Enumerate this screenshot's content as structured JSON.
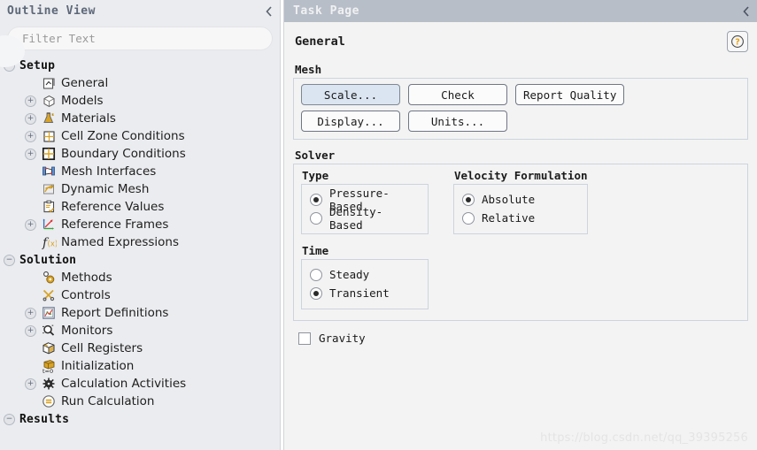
{
  "outline": {
    "title": "Outline View",
    "collapse_icon": "chevron-left-icon",
    "filter": {
      "value": "",
      "placeholder": "Filter Text"
    },
    "tree": [
      {
        "label": "Setup",
        "level": 0,
        "expander": "minus",
        "icon": "none",
        "section": true
      },
      {
        "label": "General",
        "level": 1,
        "expander": "none",
        "icon": "general-icon",
        "section": false
      },
      {
        "label": "Models",
        "level": 1,
        "expander": "plus",
        "icon": "models-icon",
        "section": false
      },
      {
        "label": "Materials",
        "level": 1,
        "expander": "plus",
        "icon": "materials-icon",
        "section": false
      },
      {
        "label": "Cell Zone Conditions",
        "level": 1,
        "expander": "plus",
        "icon": "grid-icon",
        "section": false
      },
      {
        "label": "Boundary Conditions",
        "level": 1,
        "expander": "plus",
        "icon": "grid-bold-icon",
        "section": false
      },
      {
        "label": "Mesh Interfaces",
        "level": 1,
        "expander": "none",
        "icon": "mesh-interfaces-icon",
        "section": false
      },
      {
        "label": "Dynamic Mesh",
        "level": 1,
        "expander": "none",
        "icon": "dynamic-mesh-icon",
        "section": false
      },
      {
        "label": "Reference Values",
        "level": 1,
        "expander": "none",
        "icon": "clipboard-icon",
        "section": false
      },
      {
        "label": "Reference Frames",
        "level": 1,
        "expander": "plus",
        "icon": "axes-icon",
        "section": false
      },
      {
        "label": "Named Expressions",
        "level": 1,
        "expander": "none",
        "icon": "function-icon",
        "section": false
      },
      {
        "label": "Solution",
        "level": 0,
        "expander": "minus",
        "icon": "none",
        "section": true
      },
      {
        "label": "Methods",
        "level": 1,
        "expander": "none",
        "icon": "methods-icon",
        "section": false
      },
      {
        "label": "Controls",
        "level": 1,
        "expander": "none",
        "icon": "controls-icon",
        "section": false
      },
      {
        "label": "Report Definitions",
        "level": 1,
        "expander": "plus",
        "icon": "report-icon",
        "section": false
      },
      {
        "label": "Monitors",
        "level": 1,
        "expander": "plus",
        "icon": "monitor-icon",
        "section": false
      },
      {
        "label": "Cell Registers",
        "level": 1,
        "expander": "none",
        "icon": "cell-registers-icon",
        "section": false
      },
      {
        "label": "Initialization",
        "level": 1,
        "expander": "none",
        "icon": "initialization-icon",
        "section": false
      },
      {
        "label": "Calculation Activities",
        "level": 1,
        "expander": "plus",
        "icon": "gear-dark-icon",
        "section": false
      },
      {
        "label": "Run Calculation",
        "level": 1,
        "expander": "none",
        "icon": "run-calculation-icon",
        "section": false
      },
      {
        "label": "Results",
        "level": 0,
        "expander": "minus",
        "icon": "none",
        "section": true
      }
    ]
  },
  "task_page": {
    "title": "Task Page",
    "collapse_icon": "chevron-left-icon",
    "section_title": "General",
    "help_button": {
      "icon": "help-question-icon",
      "color": "#e8a317"
    },
    "mesh": {
      "label": "Mesh",
      "buttons": [
        {
          "label": "Scale...",
          "highlight": true,
          "width": "w1"
        },
        {
          "label": "Check",
          "highlight": false,
          "width": "w1"
        },
        {
          "label": "Report Quality",
          "highlight": false,
          "width": ""
        },
        {
          "label": "Display...",
          "highlight": true,
          "width": "w1"
        },
        {
          "label": "Units...",
          "highlight": false,
          "width": "w1"
        }
      ]
    },
    "solver": {
      "label": "Solver",
      "type": {
        "label": "Type",
        "options": [
          {
            "label": "Pressure-Based",
            "checked": true
          },
          {
            "label": "Density-Based",
            "checked": false
          }
        ]
      },
      "velocity_formulation": {
        "label": "Velocity Formulation",
        "options": [
          {
            "label": "Absolute",
            "checked": true
          },
          {
            "label": "Relative",
            "checked": false
          }
        ]
      },
      "time": {
        "label": "Time",
        "options": [
          {
            "label": "Steady",
            "checked": false
          },
          {
            "label": "Transient",
            "checked": true
          }
        ]
      }
    },
    "gravity": {
      "label": "Gravity",
      "checked": false
    }
  },
  "watermark": {
    "text": "https://blog.csdn.net/qq_39395256"
  }
}
